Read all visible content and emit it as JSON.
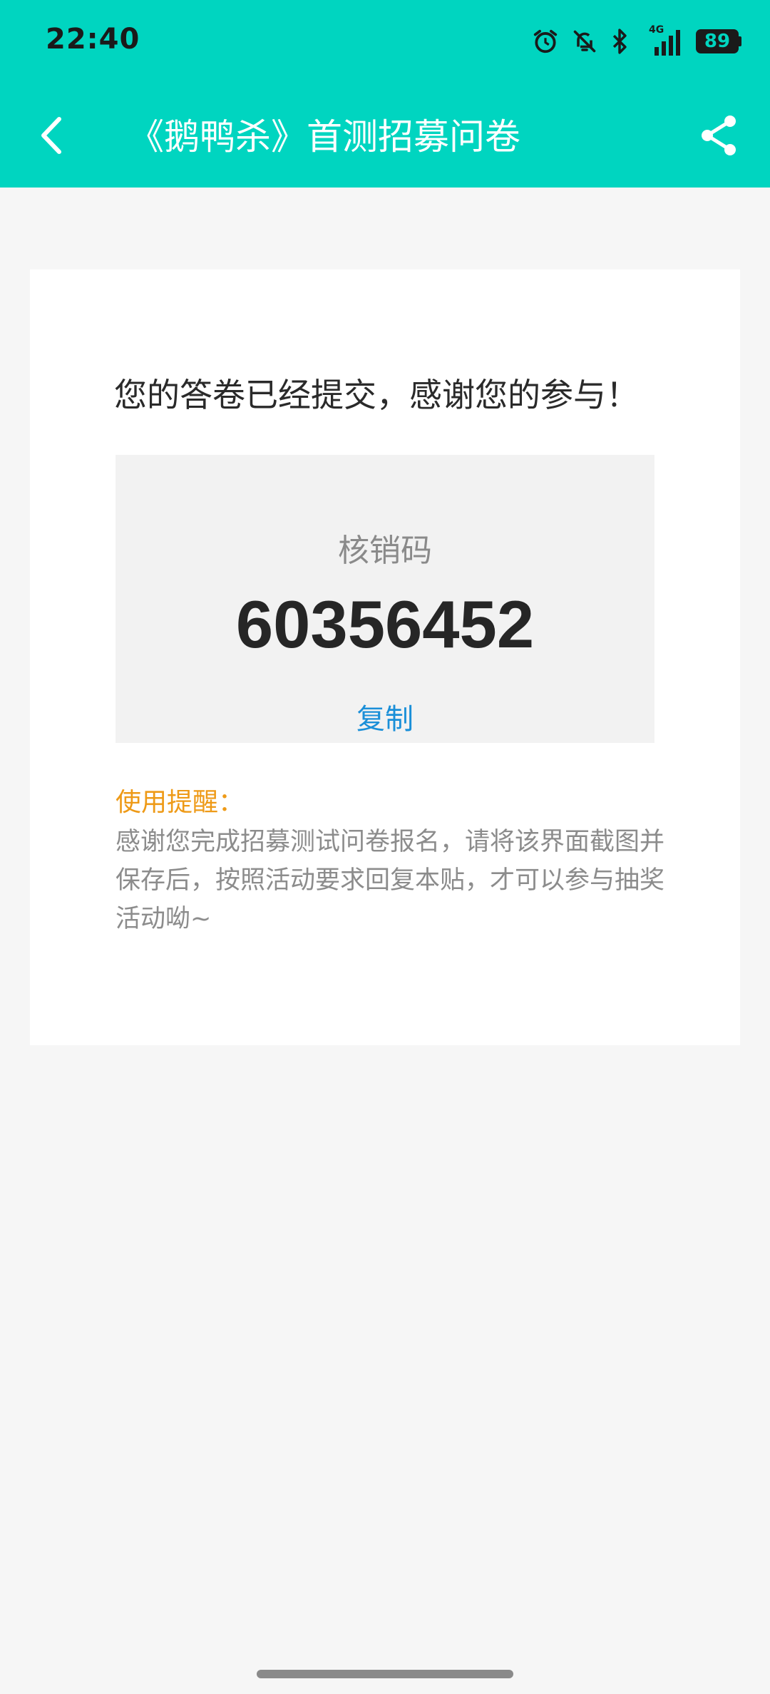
{
  "status_bar": {
    "time": "22:40",
    "network": "4G",
    "battery": "89",
    "icons": [
      "alarm-icon",
      "bell-off-icon",
      "bluetooth-icon",
      "signal-icon",
      "battery-icon"
    ]
  },
  "nav": {
    "title": "《鹅鸭杀》首测招募问卷",
    "back_icon": "chevron-left-icon",
    "share_icon": "share-icon"
  },
  "card": {
    "message": "您的答卷已经提交，感谢您的参与！",
    "code_label": "核销码",
    "code_value": "60356452",
    "copy_label": "复制",
    "tip_title": "使用提醒：",
    "tip_text": "感谢您完成招募测试问卷报名，请将该界面截图并保存后，按照活动要求回复本贴，才可以参与抽奖活动呦~"
  },
  "colors": {
    "header_bg": "#00d5c0",
    "page_bg": "#f6f6f6",
    "link": "#1a8fd8",
    "tip_title": "#ee9a17"
  }
}
